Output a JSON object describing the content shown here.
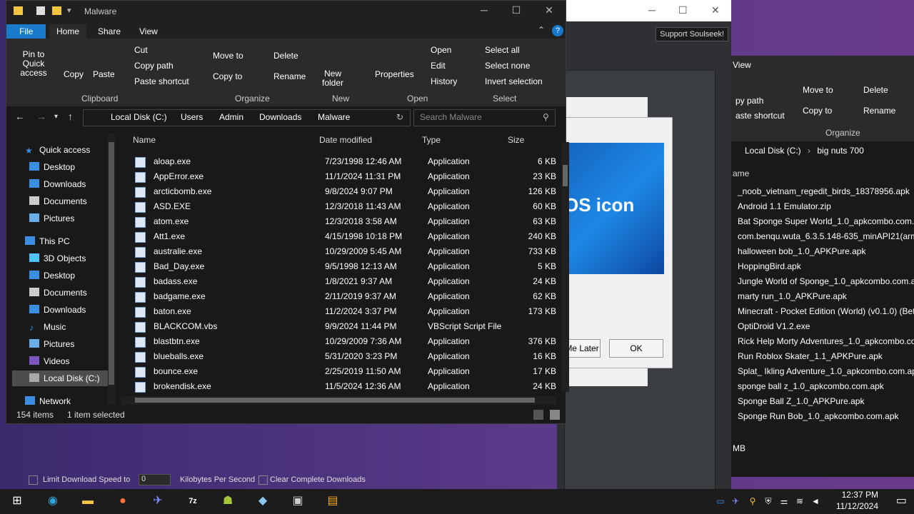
{
  "window": {
    "title": "Malware",
    "tabs": [
      "File",
      "Home",
      "Share",
      "View"
    ]
  },
  "ribbon": {
    "pin_label": "Pin to Quick access",
    "copy_label": "Copy",
    "paste_label": "Paste",
    "cut_label": "Cut",
    "copy_path_label": "Copy path",
    "paste_shortcut_label": "Paste shortcut",
    "move_to_label": "Move to",
    "copy_to_label": "Copy to",
    "delete_label": "Delete",
    "rename_label": "Rename",
    "new_folder_label": "New folder",
    "properties_label": "Properties",
    "open_label": "Open",
    "edit_label": "Edit",
    "history_label": "History",
    "select_all_label": "Select all",
    "select_none_label": "Select none",
    "invert_selection_label": "Invert selection",
    "groups": {
      "clipboard": "Clipboard",
      "organize": "Organize",
      "new": "New",
      "open": "Open",
      "select": "Select"
    }
  },
  "address": {
    "crumbs": [
      "Local Disk (C:)",
      "Users",
      "Admin",
      "Downloads",
      "Malware"
    ],
    "search_placeholder": "Search Malware"
  },
  "nav": {
    "quick_access": "Quick access",
    "quick_items": [
      "Desktop",
      "Downloads",
      "Documents",
      "Pictures"
    ],
    "this_pc": "This PC",
    "pc_items": [
      "3D Objects",
      "Desktop",
      "Documents",
      "Downloads",
      "Music",
      "Pictures",
      "Videos",
      "Local Disk (C:)"
    ],
    "network": "Network"
  },
  "columns": {
    "name": "Name",
    "date": "Date modified",
    "type": "Type",
    "size": "Size"
  },
  "files": [
    {
      "name": "aloap.exe",
      "date": "7/23/1998 12:46 AM",
      "type": "Application",
      "size": "6 KB"
    },
    {
      "name": "AppError.exe",
      "date": "11/1/2024 11:31 PM",
      "type": "Application",
      "size": "23 KB"
    },
    {
      "name": "arcticbomb.exe",
      "date": "9/8/2024 9:07 PM",
      "type": "Application",
      "size": "126 KB"
    },
    {
      "name": "ASD.EXE",
      "date": "12/3/2018 11:43 AM",
      "type": "Application",
      "size": "60 KB"
    },
    {
      "name": "atom.exe",
      "date": "12/3/2018 3:58 AM",
      "type": "Application",
      "size": "63 KB"
    },
    {
      "name": "Att1.exe",
      "date": "4/15/1998 10:18 PM",
      "type": "Application",
      "size": "240 KB"
    },
    {
      "name": "australie.exe",
      "date": "10/29/2009 5:45 AM",
      "type": "Application",
      "size": "733 KB"
    },
    {
      "name": "Bad_Day.exe",
      "date": "9/5/1998 12:13 AM",
      "type": "Application",
      "size": "5 KB"
    },
    {
      "name": "badass.exe",
      "date": "1/8/2021 9:37 AM",
      "type": "Application",
      "size": "24 KB"
    },
    {
      "name": "badgame.exe",
      "date": "2/11/2019 9:37 AM",
      "type": "Application",
      "size": "62 KB"
    },
    {
      "name": "baton.exe",
      "date": "11/2/2024 3:37 PM",
      "type": "Application",
      "size": "173 KB"
    },
    {
      "name": "BLACKCOM.vbs",
      "date": "9/9/2024 11:44 PM",
      "type": "VBScript Script File",
      "size": ""
    },
    {
      "name": "blastbtn.exe",
      "date": "10/29/2009 7:36 AM",
      "type": "Application",
      "size": "376 KB"
    },
    {
      "name": "blueballs.exe",
      "date": "5/31/2020 3:23 PM",
      "type": "Application",
      "size": "16 KB"
    },
    {
      "name": "bounce.exe",
      "date": "2/25/2019 11:50 AM",
      "type": "Application",
      "size": "17 KB"
    },
    {
      "name": "brokendisk.exe",
      "date": "11/5/2024 12:36 AM",
      "type": "Application",
      "size": "24 KB"
    }
  ],
  "status": {
    "count": "154 items",
    "selected": "1 item selected"
  },
  "background": {
    "support_btn": "Support Soulseek!",
    "dialog_text": "OS icon",
    "later_btn": "Me Later",
    "ok_btn": "OK",
    "right_explorer": {
      "view_tab": "View",
      "move_to": "Move to",
      "delete": "Delete",
      "copy_to": "Copy to",
      "rename": "Rename",
      "copy_path": "py path",
      "paste_shortcut": "aste shortcut",
      "organize": "Organize",
      "crumbs": [
        "Local Disk (C:)",
        "big nuts 700"
      ],
      "name_col": "ame",
      "status": "MB",
      "files": [
        "_noob_vietnam_regedit_birds_18378956.apk",
        "Android 1.1 Emulator.zip",
        "Bat Sponge Super World_1.0_apkcombo.com.a",
        "com.benqu.wuta_6.3.5.148-635_minAPI21(arm",
        "halloween bob_1.0_APKPure.apk",
        "HoppingBird.apk",
        "Jungle World of Sponge_1.0_apkcombo.com.ap",
        "marty run_1.0_APKPure.apk",
        "Minecraft - Pocket Edition (World) (v0.1.0) (Bet",
        "OptiDroid V1.2.exe",
        "Rick Help Morty Adventures_1.0_apkcombo.co",
        "Run Roblox Skater_1.1_APKPure.apk",
        "Splat_ Ikling Adventure_1.0_apkcombo.com.ap",
        "sponge ball z_1.0_apkcombo.com.apk",
        "Sponge Ball Z_1.0_APKPure.apk",
        "Sponge Run Bob_1.0_apkcombo.com.apk"
      ]
    },
    "strip": {
      "limit": "Limit Download Speed to",
      "speed": "0",
      "unit": "Kilobytes Per Second",
      "clear": "Clear Complete Downloads"
    }
  },
  "taskbar": {
    "time": "12:37 PM",
    "date": "11/12/2024"
  }
}
